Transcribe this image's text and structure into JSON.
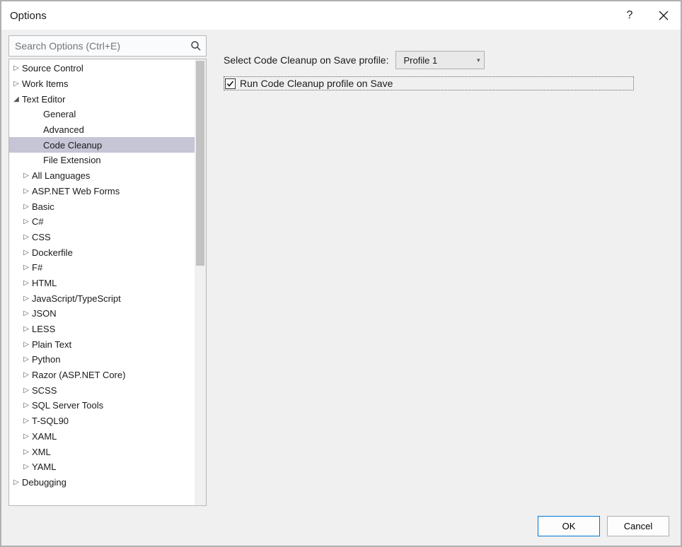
{
  "window": {
    "title": "Options"
  },
  "search": {
    "placeholder": "Search Options (Ctrl+E)"
  },
  "tree": [
    {
      "label": "Source Control",
      "depth": 0,
      "icon": "right",
      "selected": false
    },
    {
      "label": "Work Items",
      "depth": 0,
      "icon": "right",
      "selected": false
    },
    {
      "label": "Text Editor",
      "depth": 0,
      "icon": "down",
      "selected": false
    },
    {
      "label": "General",
      "depth": 1,
      "icon": "none",
      "selected": false
    },
    {
      "label": "Advanced",
      "depth": 1,
      "icon": "none",
      "selected": false
    },
    {
      "label": "Code Cleanup",
      "depth": 1,
      "icon": "none",
      "selected": true
    },
    {
      "label": "File Extension",
      "depth": 1,
      "icon": "none",
      "selected": false
    },
    {
      "label": "All Languages",
      "depth": 1,
      "icon": "right",
      "selected": false
    },
    {
      "label": "ASP.NET Web Forms",
      "depth": 1,
      "icon": "right",
      "selected": false
    },
    {
      "label": "Basic",
      "depth": 1,
      "icon": "right",
      "selected": false
    },
    {
      "label": "C#",
      "depth": 1,
      "icon": "right",
      "selected": false
    },
    {
      "label": "CSS",
      "depth": 1,
      "icon": "right",
      "selected": false
    },
    {
      "label": "Dockerfile",
      "depth": 1,
      "icon": "right",
      "selected": false
    },
    {
      "label": "F#",
      "depth": 1,
      "icon": "right",
      "selected": false
    },
    {
      "label": "HTML",
      "depth": 1,
      "icon": "right",
      "selected": false
    },
    {
      "label": "JavaScript/TypeScript",
      "depth": 1,
      "icon": "right",
      "selected": false
    },
    {
      "label": "JSON",
      "depth": 1,
      "icon": "right",
      "selected": false
    },
    {
      "label": "LESS",
      "depth": 1,
      "icon": "right",
      "selected": false
    },
    {
      "label": "Plain Text",
      "depth": 1,
      "icon": "right",
      "selected": false
    },
    {
      "label": "Python",
      "depth": 1,
      "icon": "right",
      "selected": false
    },
    {
      "label": "Razor (ASP.NET Core)",
      "depth": 1,
      "icon": "right",
      "selected": false
    },
    {
      "label": "SCSS",
      "depth": 1,
      "icon": "right",
      "selected": false
    },
    {
      "label": "SQL Server Tools",
      "depth": 1,
      "icon": "right",
      "selected": false
    },
    {
      "label": "T-SQL90",
      "depth": 1,
      "icon": "right",
      "selected": false
    },
    {
      "label": "XAML",
      "depth": 1,
      "icon": "right",
      "selected": false
    },
    {
      "label": "XML",
      "depth": 1,
      "icon": "right",
      "selected": false
    },
    {
      "label": "YAML",
      "depth": 1,
      "icon": "right",
      "selected": false
    },
    {
      "label": "Debugging",
      "depth": 0,
      "icon": "right",
      "selected": false
    }
  ],
  "panel": {
    "profile_label": "Select Code Cleanup on Save profile:",
    "profile_selected": "Profile 1",
    "checkbox_label": "Run Code Cleanup profile on Save",
    "checkbox_checked": true
  },
  "footer": {
    "ok": "OK",
    "cancel": "Cancel"
  }
}
